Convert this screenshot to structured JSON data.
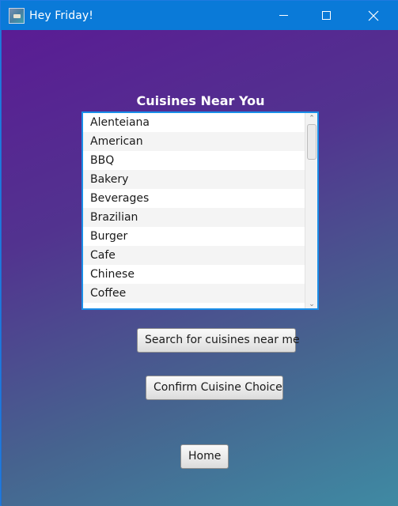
{
  "window": {
    "title": "Hey Friday!",
    "icon": "app-icon",
    "controls": [
      "minimize-icon",
      "maximize-icon",
      "close-icon"
    ]
  },
  "main": {
    "heading": "Cuisines Near You",
    "cuisines": [
      "Alenteiana",
      "American",
      "BBQ",
      "Bakery",
      "Beverages",
      "Brazilian",
      "Burger",
      "Cafe",
      "Chinese",
      "Coffee"
    ],
    "buttons": {
      "search": "Search for cuisines near me",
      "confirm": "Confirm Cuisine Choice",
      "home": "Home"
    }
  },
  "colors": {
    "titlebar": "#0a7ad8",
    "gradient_start": "#5a1c94",
    "gradient_end": "#3f8aa3",
    "list_border": "#1a8ee8"
  }
}
